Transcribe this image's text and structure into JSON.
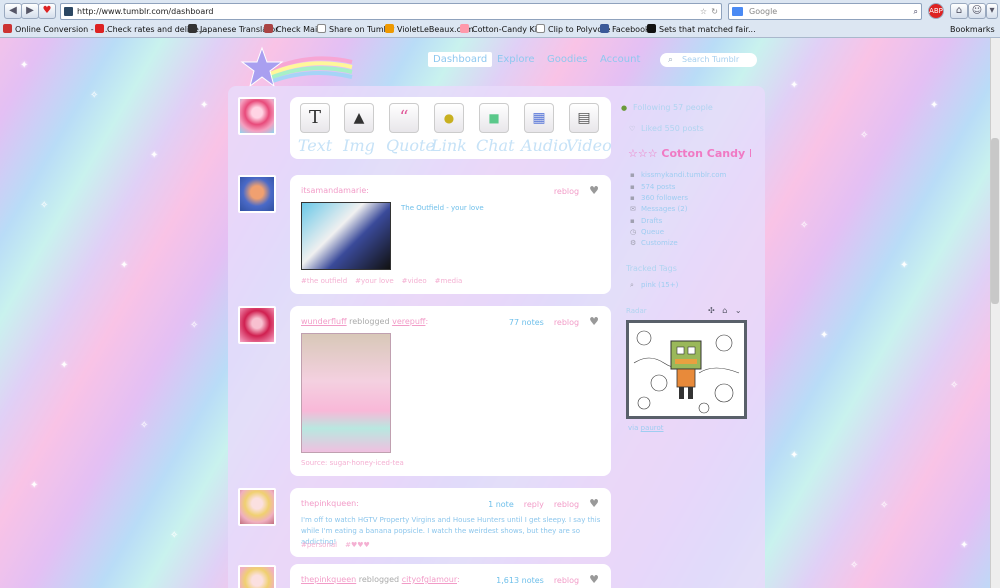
{
  "browser": {
    "url": "http://www.tumblr.com/dashboard",
    "search_placeholder": "Google",
    "bookmarks": [
      {
        "label": "Online Conversion - P...",
        "color": "#c33"
      },
      {
        "label": "Check rates and delive...",
        "color": "#d22"
      },
      {
        "label": "Japanese Translator",
        "color": "#333"
      },
      {
        "label": "Check Mail",
        "color": "#a44"
      },
      {
        "label": "Share on Tumblr",
        "color": "#fff"
      },
      {
        "label": "VioletLeBeaux.com",
        "color": "#e90"
      },
      {
        "label": "Cotton-Candy Kiss",
        "color": "#f9a"
      },
      {
        "label": "Clip to Polyvore",
        "color": "#fff"
      },
      {
        "label": "Facebook",
        "color": "#3b5998"
      },
      {
        "label": "Sets that matched fair...",
        "color": "#111"
      }
    ],
    "bookmarks_menu": "Bookmarks"
  },
  "nav": {
    "dashboard": "Dashboard",
    "explore": "Explore",
    "goodies": "Goodies",
    "account": "Account",
    "search_placeholder": "Search Tumblr"
  },
  "post_types": [
    "Text",
    "Img",
    "Quote",
    "Link",
    "Chat",
    "Audio",
    "Video"
  ],
  "posts": [
    {
      "user": "itsamandamarie:",
      "reblog": "reblog",
      "caption": "The Outfield - your love",
      "tags": [
        "#the outfield",
        "#your love",
        "#video",
        "#media"
      ]
    },
    {
      "user": "wunderfluff",
      "reblogged": "reblogged",
      "from": "verepuff",
      "colon": ":",
      "notes": "77 notes",
      "reblog": "reblog",
      "source": "Source: sugar-honey-iced-tea"
    },
    {
      "user": "thepinkqueen:",
      "notes": "1 note",
      "reply": "reply",
      "reblog": "reblog",
      "body": "I'm off to watch HGTV Property Virgins and House Hunters until I get sleepy. I say this while I'm eating a banana popsicle. I watch the weirdest shows, but they are so addicting!",
      "tags": [
        "#personal",
        "#♥♥♥"
      ]
    },
    {
      "user": "thepinkqueen",
      "reblogged": "reblogged",
      "from": "cityofglamour",
      "colon": ":",
      "notes": "1,613 notes",
      "reblog": "reblog"
    }
  ],
  "sidebar": {
    "following": "Following 57 people",
    "liked": "Liked 550 posts",
    "blog_name": "☆☆☆ Cotton Candy Kis",
    "blog_items": [
      "kissmykandi.tumblr.com",
      "574 posts",
      "360 followers",
      "Messages (2)",
      "Drafts",
      "Queue",
      "Customize"
    ],
    "tracked_tags_title": "Tracked Tags",
    "tracked_tag": "pink (15+)",
    "radar_title": "Radar",
    "radar_via": "via",
    "radar_user": "paurot"
  },
  "colors": {
    "pink": "#f29cc8",
    "blue": "#6ebfea",
    "panel": "#e8dafa"
  }
}
